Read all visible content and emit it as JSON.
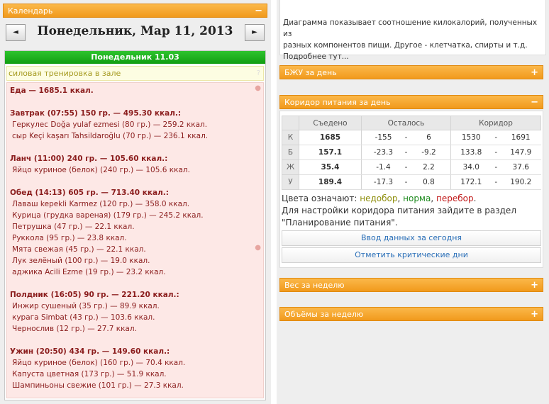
{
  "calendar": {
    "title": "Календарь",
    "toggle": "−",
    "prev": "◄",
    "next": "►",
    "date": "Понедельник, Мар 11, 2013",
    "day_header": "Понедельник 11.03",
    "workout": "силовая тренировка в зале",
    "workout_help": "?"
  },
  "diary": {
    "total": "Еда — 1685.1 ккал.",
    "meals": [
      {
        "header": "Завтрак (07:55) 150 гр. — 495.30 ккал.:",
        "items": [
          "Геркулес Doğa yulaf ezmesi (80 гр.) — 259.2 ккал.",
          "сыр Keçi kaşarı Tahsildaroğlu (70 гр.) — 236.1 ккал."
        ]
      },
      {
        "header": "Ланч (11:00) 240 гр. — 105.60 ккал.:",
        "items": [
          "Яйцо куриное (белок) (240 гр.) — 105.6 ккал."
        ]
      },
      {
        "header": "Обед (14:13) 605 гр. — 713.40 ккал.:",
        "items": [
          "Лаваш kepekli Karmez (120 гр.) — 358.0 ккал.",
          "Курица (грудка вареная) (179 гр.) — 245.2 ккал.",
          "Петрушка (47 гр.) — 22.1 ккал.",
          "Руккола (95 гр.) — 23.8 ккал.",
          "Мята свежая (45 гр.) — 22.1 ккал.",
          "Лук зелёный (100 гр.) — 19.0 ккал.",
          "аджика Acili Ezme (19 гр.) — 23.2 ккал."
        ]
      },
      {
        "header": "Полдник (16:05) 90 гр. — 221.20 ккал.:",
        "items": [
          "Инжир сушеный (35 гр.) — 89.9 ккал.",
          "курага Simbat (43 гр.) — 103.6 ккал.",
          "Чернослив (12 гр.) — 27.7 ккал."
        ]
      },
      {
        "header": "Ужин (20:50) 434 гр. — 149.60 ккал.:",
        "items": [
          "Яйцо куриное (белок) (160 гр.) — 70.4 ккал.",
          "Капуста цветная (173 гр.) — 51.9 ккал.",
          "Шампиньоны свежие (101 гр.) — 27.3 ккал."
        ]
      }
    ]
  },
  "info": {
    "line1": "Диаграмма показывает соотношение килокалорий, полученных из",
    "line2": "разных компонентов пищи. Другое - клетчатка, спирты и т.д.",
    "line3": "Подробнее тут..."
  },
  "panels": {
    "bju": "БЖУ за день",
    "corridor": "Коридор питания за день",
    "week_weight": "Вес за неделю",
    "week_volume": "Объёмы за неделю",
    "plus": "+",
    "minus": "−"
  },
  "corridor_table": {
    "headers": [
      "Съедено",
      "Осталось",
      "Коридор"
    ],
    "rows": [
      {
        "label": "К",
        "eaten": "1685",
        "eaten_color": "green",
        "left_min": "-155",
        "left_max": "6",
        "c_min": "1530",
        "c_max": "1691"
      },
      {
        "label": "Б",
        "eaten": "157.1",
        "eaten_color": "red",
        "left_min": "-23.3",
        "left_max": "-9.2",
        "c_min": "133.8",
        "c_max": "147.9"
      },
      {
        "label": "Ж",
        "eaten": "35.4",
        "eaten_color": "olive",
        "left_min": "-1.4",
        "left_max": "2.2",
        "c_min": "34.0",
        "c_max": "37.6"
      },
      {
        "label": "У",
        "eaten": "189.4",
        "eaten_color": "green",
        "left_min": "-17.3",
        "left_max": "0.8",
        "c_min": "172.1",
        "c_max": "190.2"
      }
    ],
    "dash": "-"
  },
  "legend": {
    "prefix": "Цвета означают: ",
    "under": "недобор",
    "norm": "норма",
    "over": "перебор",
    "sep1": ", ",
    "sep2": ", ",
    "end": ".",
    "hint1": "Для настройки коридора питания зайдите в раздел",
    "hint2": "\"Планирование питания\"."
  },
  "buttons": {
    "enter_today": "Ввод данных за сегодня",
    "critical_days": "Отметить критические дни"
  },
  "colors": {
    "orange": "#f5a623",
    "green_header": "#22b422",
    "under": "#8e8e0c",
    "norm": "#1d8a1d",
    "over": "#c11a1a"
  }
}
